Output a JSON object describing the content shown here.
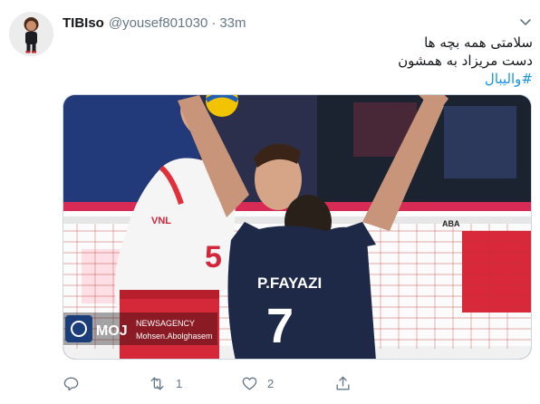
{
  "tweet": {
    "author": {
      "display_name": "TIBIso",
      "handle": "@yousef801030",
      "separator": "·",
      "time": "33m",
      "avatar_icon": "avatar-photo"
    },
    "text_lines": [
      "سلامتی همه بچه ها",
      "دست مریزاد به همشون"
    ],
    "hashtag": "#والیبال",
    "media": {
      "description_icon": "volleyball-photo",
      "jersey_name": "P.FAYAZI",
      "jersey_number": "7",
      "opponent_number": "5",
      "opponent_logo": "VNL",
      "watermark_brand": "MOJ",
      "watermark_agency": "NEWSAGENCY",
      "watermark_credit": "Mohsen.Abolghasem",
      "ad_text": "ABA"
    },
    "actions": {
      "reply_count": "",
      "retweet_count": "1",
      "like_count": "2"
    }
  },
  "colors": {
    "text": "#14171a",
    "muted": "#657786",
    "link": "#1b95e0",
    "border": "#ccd6dd"
  }
}
